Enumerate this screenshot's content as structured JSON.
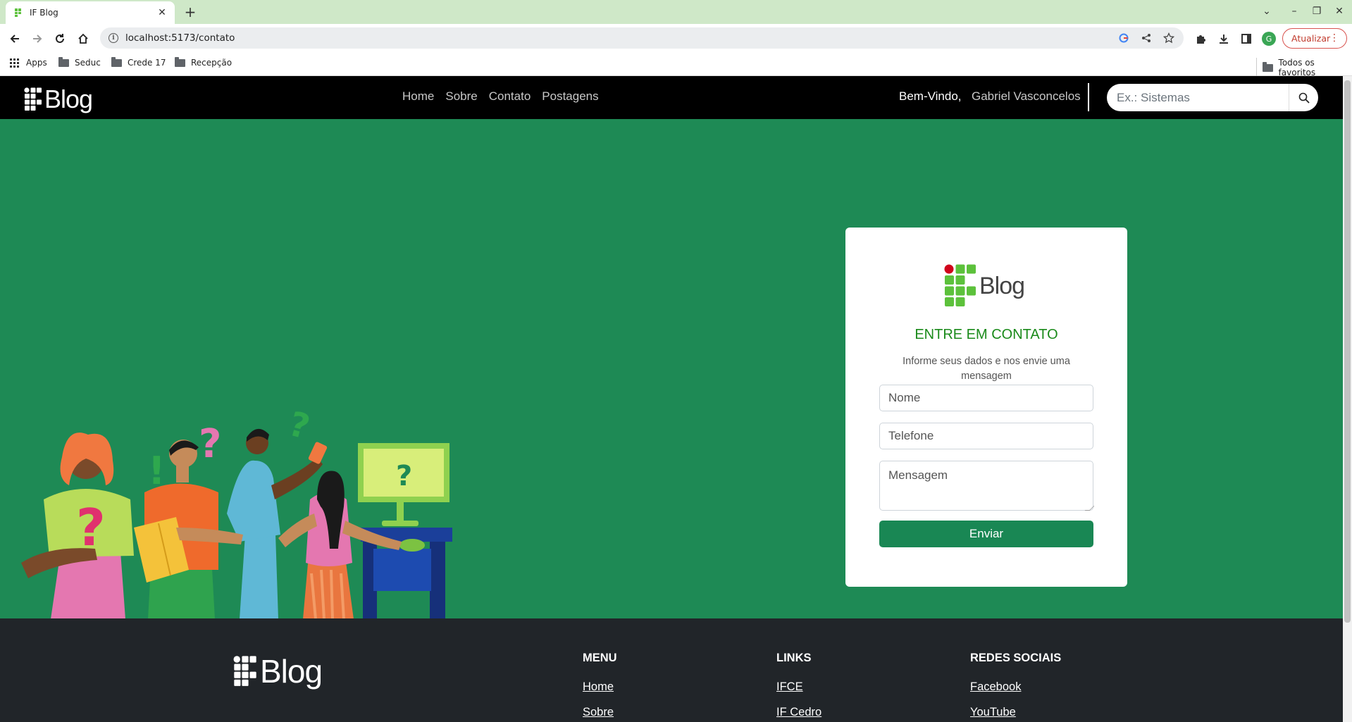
{
  "browser": {
    "tab_title": "IF Blog",
    "url": "localhost:5173/contato",
    "update_label": "Atualizar",
    "profile_initial": "G",
    "bookmarks": [
      {
        "label": "Apps",
        "icon": "apps-grid-icon"
      },
      {
        "label": "Seduc",
        "icon": "folder-icon"
      },
      {
        "label": "Crede 17",
        "icon": "folder-icon"
      },
      {
        "label": "Recepção",
        "icon": "folder-icon"
      }
    ],
    "all_bookmarks_label": "Todos os favoritos"
  },
  "navbar": {
    "brand": "Blog",
    "links": [
      "Home",
      "Sobre",
      "Contato",
      "Postagens"
    ],
    "welcome": "Bem-Vindo,",
    "username": "Gabriel Vasconcelos",
    "search_placeholder": "Ex.: Sistemas"
  },
  "contact": {
    "logo_text": "Blog",
    "title": "ENTRE EM CONTATO",
    "subtitle": "Informe seus dados e nos envie uma mensagem",
    "name_placeholder": "Nome",
    "phone_placeholder": "Telefone",
    "message_placeholder": "Mensagem",
    "submit_label": "Enviar"
  },
  "footer": {
    "logo_text": "Blog",
    "columns": [
      {
        "title": "MENU",
        "links": [
          "Home",
          "Sobre"
        ]
      },
      {
        "title": "LINKS",
        "links": [
          "IFCE",
          "IF Cedro"
        ]
      },
      {
        "title": "REDES SOCIAIS",
        "links": [
          "Facebook",
          "YouTube"
        ]
      }
    ]
  },
  "colors": {
    "hero_bg": "#1e8a55",
    "navbar_bg": "#000000",
    "footer_bg": "#212529",
    "accent_green": "#198754",
    "logo_dot_red": "#d0021b",
    "logo_square_green": "#5cc13b"
  }
}
